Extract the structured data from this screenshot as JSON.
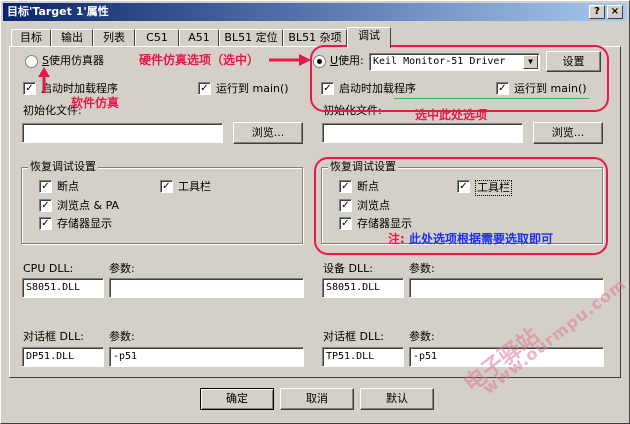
{
  "window": {
    "title": "目标'Target 1'属性",
    "help_btn": "?",
    "close_btn": "×"
  },
  "tabs": [
    "目标",
    "输出",
    "列表",
    "C51",
    "A51",
    "BL51 定位",
    "BL51 杂项",
    "调试"
  ],
  "left": {
    "use_simulator": "使用仿真器",
    "use_simulator_hotkey": "S",
    "load_at_startup": "启动时加载程序",
    "run_to_main": "运行到 main()",
    "init_file_label": "初始化文件:",
    "init_file_value": "",
    "browse": "浏览...",
    "restore_group": "恢复调试设置",
    "breakpoints": "断点",
    "toolbar": "工具栏",
    "watchpoints": "浏览点 & PA",
    "memory_display": "存储器显示",
    "cpu_dll_label": "CPU DLL:",
    "cpu_param_label": "参数:",
    "cpu_dll_value": "S8051.DLL",
    "cpu_param_value": "",
    "dialog_dll_label": "对话框 DLL:",
    "dialog_param_label": "参数:",
    "dialog_dll_value": "DP51.DLL",
    "dialog_param_value": "-p51"
  },
  "right": {
    "use_label": "使用:",
    "use_hotkey": "U",
    "driver_value": "Keil Monitor-51 Driver",
    "settings": "设置",
    "load_at_startup": "启动时加载程序",
    "run_to_main": "运行到 main()",
    "init_file_label": "初始化文件:",
    "init_file_value": "",
    "browse": "浏览...",
    "restore_group": "恢复调试设置",
    "breakpoints": "断点",
    "toolbar": "工具栏",
    "watchpoints": "浏览点",
    "memory_display": "存储器显示",
    "drv_dll_label": "设备 DLL:",
    "drv_param_label": "参数:",
    "drv_dll_value": "S8051.DLL",
    "drv_param_value": "",
    "dialog_dll_label": "对话框 DLL:",
    "dialog_param_label": "参数:",
    "dialog_dll_value": "TP51.DLL",
    "dialog_param_value": "-p51"
  },
  "buttons": {
    "ok": "确定",
    "cancel": "取消",
    "default": "默认"
  },
  "annotations": {
    "hardware": "硬件仿真选项（选中）",
    "software": "软件仿真",
    "select_here": "选中此处选项",
    "note_prefix": "注:",
    "note_text": "此处选项根据需要选取即可"
  },
  "watermark": {
    "cn": "电子驿站",
    "en": "www.ourmpu.com"
  },
  "colors": {
    "annotation": "#e6194b",
    "note_blue": "#1f2ff0",
    "title_bar": "#0a246a"
  }
}
